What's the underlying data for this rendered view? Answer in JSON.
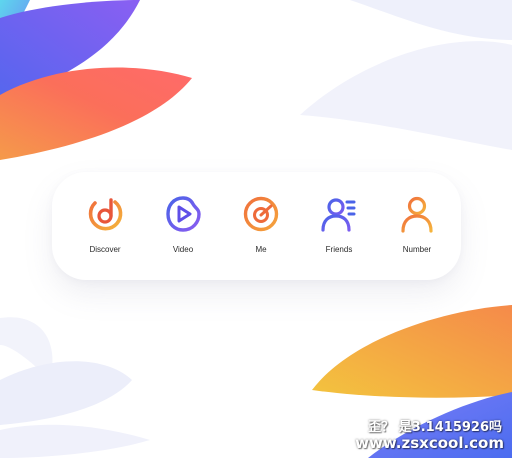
{
  "tabs": [
    {
      "label": "Discover",
      "icon": "discover-icon"
    },
    {
      "label": "Video",
      "icon": "video-play-icon"
    },
    {
      "label": "Me",
      "icon": "me-icon"
    },
    {
      "label": "Friends",
      "icon": "friends-icon"
    },
    {
      "label": "Number",
      "icon": "number-user-icon"
    }
  ],
  "watermark": {
    "line1": "歪？ 是3.1415926吗",
    "line2": "www.zsxcool.com"
  },
  "colors": {
    "orange": "#f0703c",
    "yellow": "#f5b43c",
    "blue": "#4a63e8",
    "purple": "#7a5cf0",
    "label": "#2b2b2b"
  }
}
